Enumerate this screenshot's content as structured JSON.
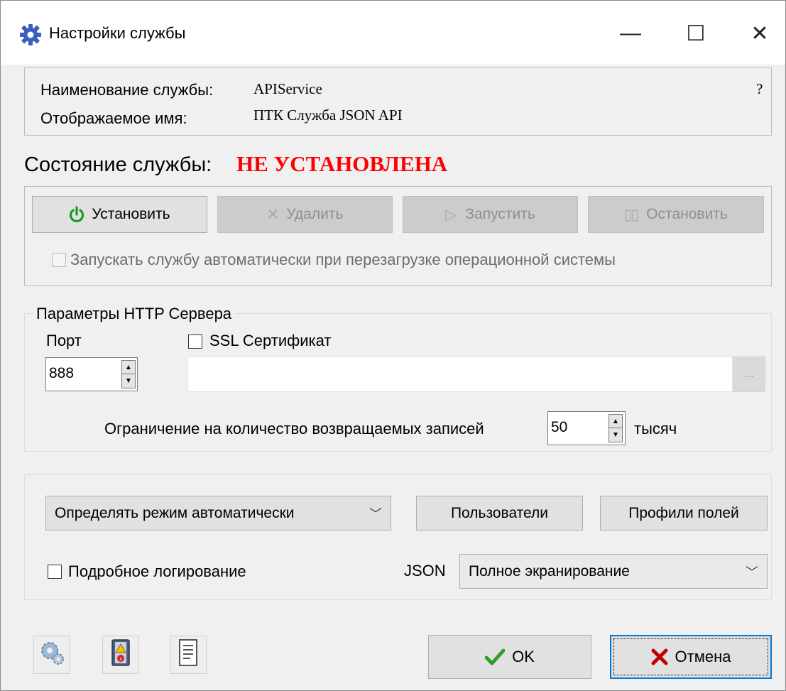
{
  "window": {
    "title": "Настройки службы",
    "icon": "gear-icon",
    "controls": {
      "minimize": "—",
      "maximize": "☐",
      "close": "✕"
    }
  },
  "service_info": {
    "name_label": "Наименование службы:",
    "name_value": "APIService",
    "display_label": "Отображаемое имя:",
    "display_value": "ПТК Служба JSON API",
    "help": "?"
  },
  "status": {
    "label": "Состояние службы:",
    "value": "НЕ УСТАНОВЛЕНА",
    "value_color": "#ff0000"
  },
  "actions": {
    "install": "Установить",
    "remove": "Удалить",
    "start": "Запустить",
    "stop": "Остановить",
    "autostart_label": "Запускать службу автоматически при перезагрузке операционной системы"
  },
  "http": {
    "group_label": "Параметры HTTP Сервера",
    "port_label": "Порт",
    "port_value": "888",
    "ssl_label": "SSL Сертификат",
    "ssl_path": "",
    "browse": "...",
    "limit_label": "Ограничение на количество возвращаемых записей",
    "limit_value": "50",
    "limit_unit": "тысяч"
  },
  "options": {
    "mode_select": "Определять режим автоматически",
    "users_button": "Пользователи",
    "profiles_button": "Профили полей",
    "verbose_log_label": "Подробное логирование",
    "json_label": "JSON",
    "json_select": "Полное экранирование"
  },
  "footer": {
    "ok": "OK",
    "cancel": "Отмена"
  },
  "colors": {
    "accent_power": "#1a9a1a",
    "ok_check": "#2e9e2e",
    "cancel_x": "#c00000"
  }
}
